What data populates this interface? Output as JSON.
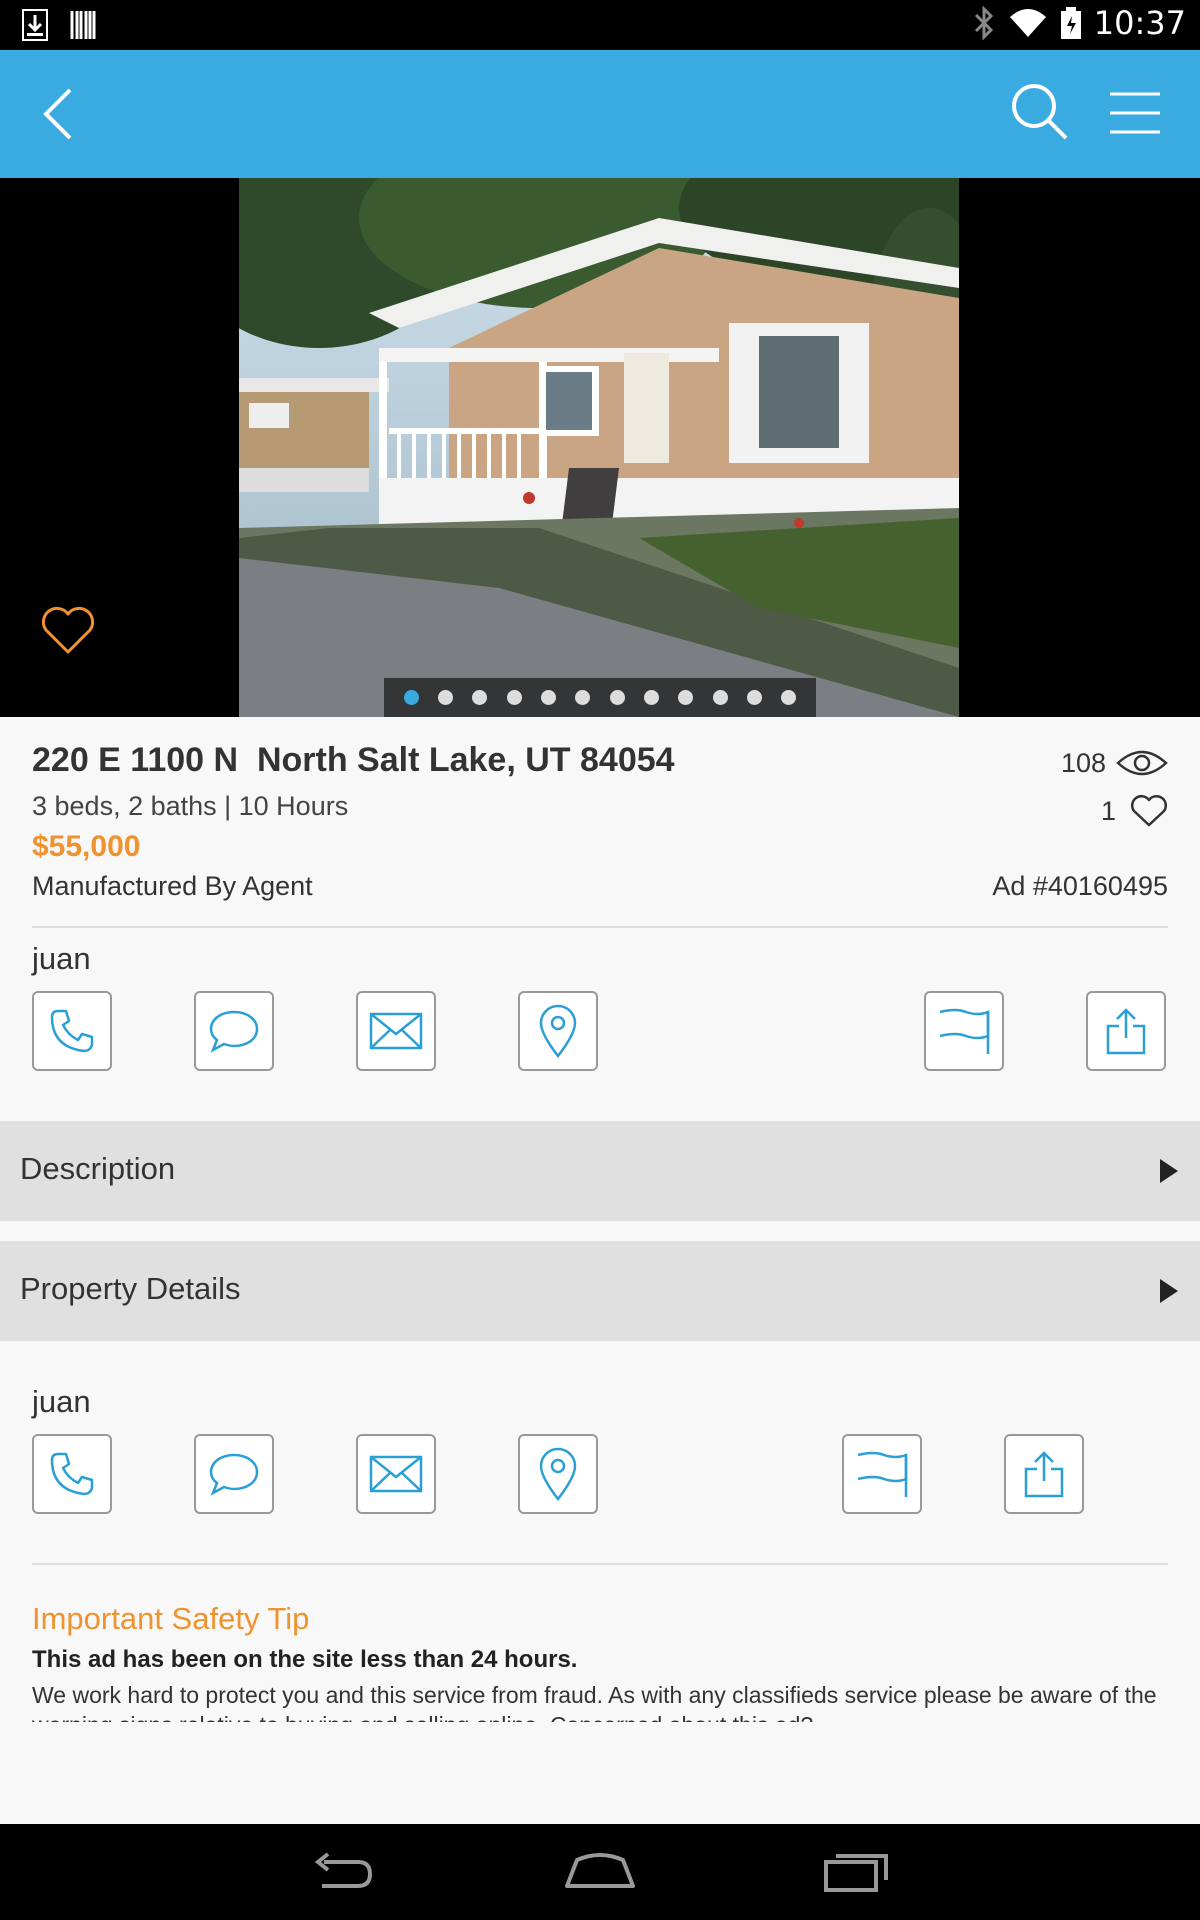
{
  "status_bar": {
    "time": "10:37"
  },
  "listing": {
    "address": "220 E 1100 N  North Salt Lake, UT 84054",
    "details": "3 beds, 2 baths  |  10 Hours",
    "price": "$55,000",
    "posted_by": "Manufactured By Agent",
    "views": "108",
    "likes": "1",
    "ad_number": "Ad #40160495",
    "photo_count": 12,
    "active_photo": 1
  },
  "seller": {
    "name": "juan"
  },
  "sections": [
    {
      "label": "Description"
    },
    {
      "label": "Property Details"
    }
  ],
  "safety": {
    "title": "Important Safety Tip",
    "bold": "This ad has been on the site less than 24 hours.",
    "text": "We work hard to protect you and this service from fraud. As with any classifieds service please be aware of the warning signs relative to buying and selling online. Concerned about this ad?"
  },
  "colors": {
    "accent": "#3aabe0",
    "price": "#f0922f",
    "icon": "#2a9fd6"
  }
}
